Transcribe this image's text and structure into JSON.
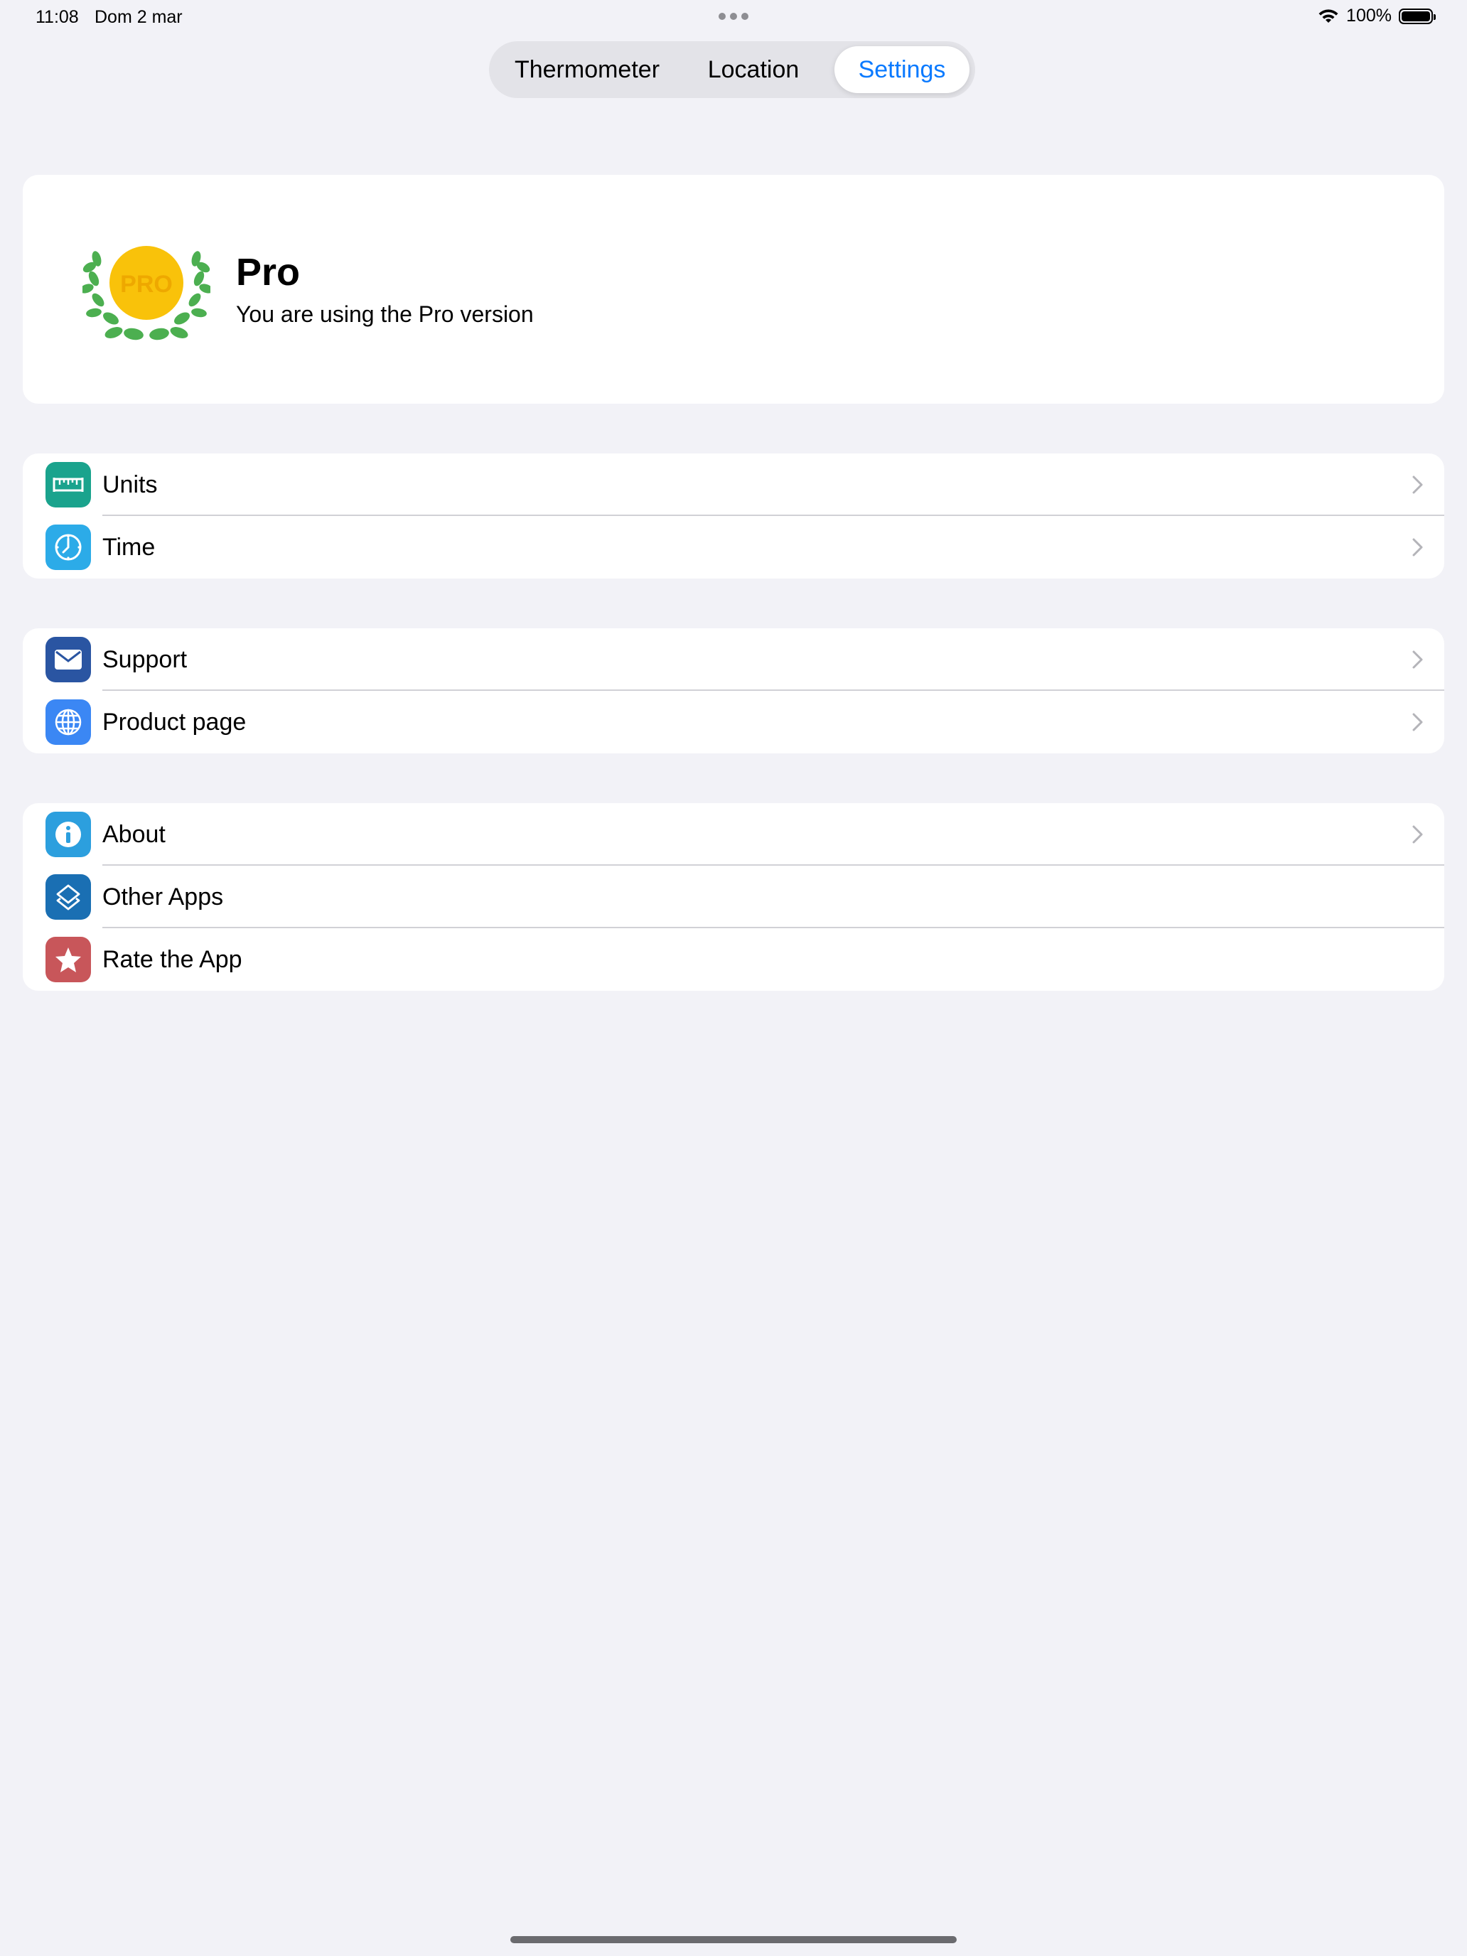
{
  "status_bar": {
    "time": "11:08",
    "date": "Dom 2 mar",
    "battery": "100%"
  },
  "tabs": [
    {
      "label": "Thermometer",
      "selected": false
    },
    {
      "label": "Location",
      "selected": false
    },
    {
      "label": "Settings",
      "selected": true
    }
  ],
  "pro": {
    "badge_text": "PRO",
    "title": "Pro",
    "subtitle": "You are using the Pro version"
  },
  "groups": [
    [
      {
        "label": "Units",
        "icon": "ruler-icon",
        "color": "#1aa38d",
        "chevron": true
      },
      {
        "label": "Time",
        "icon": "clock-icon",
        "color": "#2cabe8",
        "chevron": true
      }
    ],
    [
      {
        "label": "Support",
        "icon": "envelope-icon",
        "color": "#2a55a2",
        "chevron": true
      },
      {
        "label": "Product page",
        "icon": "globe-icon",
        "color": "#3b87f4",
        "chevron": true
      }
    ],
    [
      {
        "label": "About",
        "icon": "info-icon",
        "color": "#2c9fde",
        "chevron": true
      },
      {
        "label": "Other Apps",
        "icon": "layers-icon",
        "color": "#1a6fb3",
        "chevron": false
      },
      {
        "label": "Rate the App",
        "icon": "star-icon",
        "color": "#c8565a",
        "chevron": false
      }
    ]
  ],
  "colors": {
    "accent": "#0a7aff",
    "background": "#f2f2f7",
    "badge_gold": "#f9c20a",
    "laurel_green": "#4caf50"
  }
}
